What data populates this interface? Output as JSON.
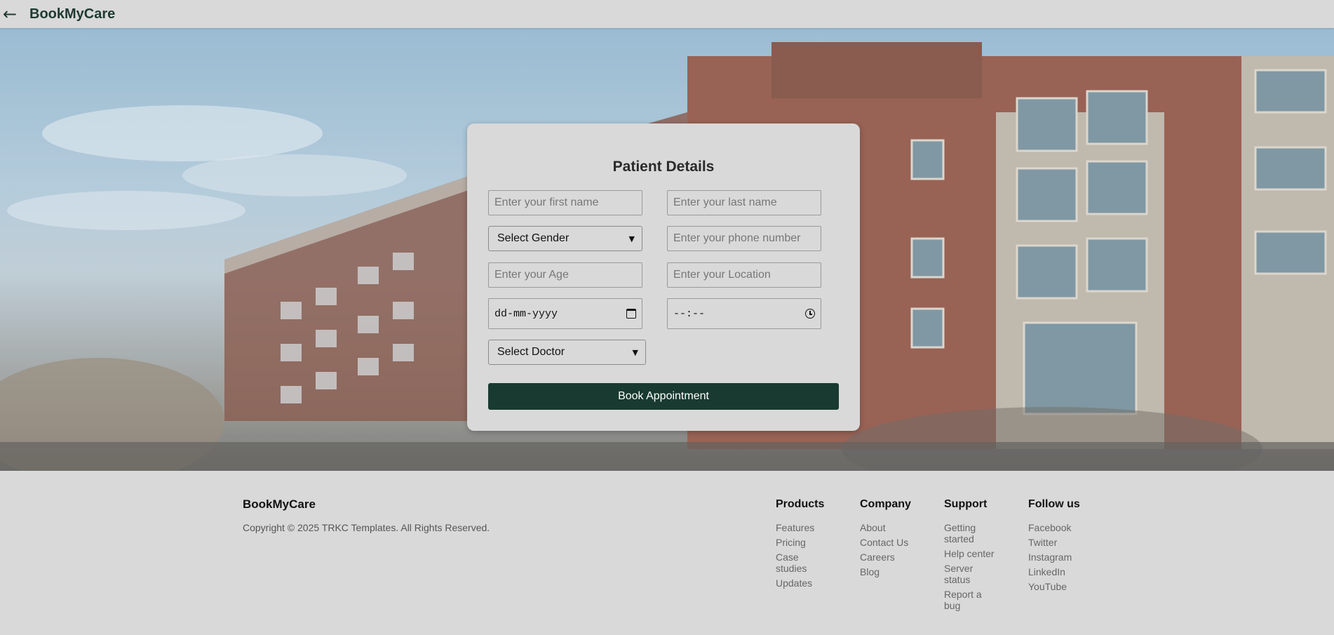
{
  "header": {
    "back_icon": "←",
    "brand": "BookMyCare"
  },
  "form": {
    "title": "Patient Details",
    "first_name_placeholder": "Enter your first name",
    "last_name_placeholder": "Enter your last name",
    "gender_selected": "Select Gender",
    "phone_placeholder": "Enter your phone number",
    "age_placeholder": "Enter your Age",
    "location_placeholder": "Enter your Location",
    "date_value": "dd-mm-yyyy",
    "time_value": "--:--",
    "doctor_selected": "Select Doctor",
    "submit_label": "Book Appointment",
    "button_color": "#193a30"
  },
  "footer": {
    "brand": "BookMyCare",
    "copyright": "Copyright © 2025 TRKC Templates. All Rights Reserved.",
    "columns": [
      {
        "title": "Products",
        "links": [
          "Features",
          "Pricing",
          "Case studies",
          "Updates"
        ]
      },
      {
        "title": "Company",
        "links": [
          "About",
          "Contact Us",
          "Careers",
          "Blog"
        ]
      },
      {
        "title": "Support",
        "links": [
          "Getting started",
          "Help center",
          "Server status",
          "Report a bug"
        ]
      },
      {
        "title": "Follow us",
        "links": [
          "Facebook",
          "Twitter",
          "Instagram",
          "LinkedIn",
          "YouTube"
        ]
      }
    ]
  }
}
